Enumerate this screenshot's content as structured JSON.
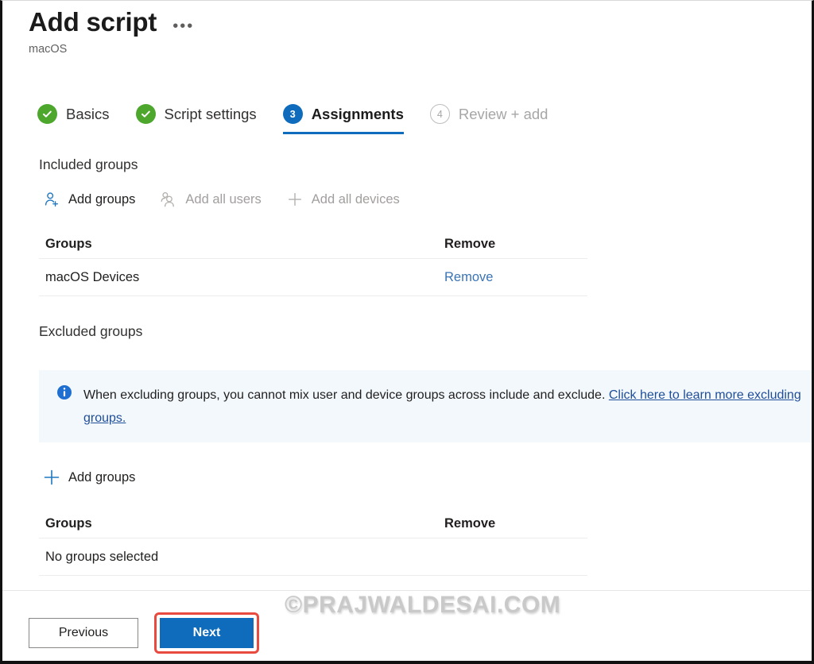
{
  "header": {
    "title": "Add script",
    "subtitle": "macOS",
    "overflow_menu": "•••"
  },
  "wizard": {
    "steps": [
      {
        "label": "Basics",
        "state": "done",
        "badge": "✓",
        "icon": "check-circle-icon"
      },
      {
        "label": "Script settings",
        "state": "done",
        "badge": "✓",
        "icon": "check-circle-icon"
      },
      {
        "label": "Assignments",
        "state": "active",
        "badge": "3",
        "icon": "step-badge-3"
      },
      {
        "label": "Review + add",
        "state": "todo",
        "badge": "4",
        "icon": "step-badge-4"
      }
    ]
  },
  "included": {
    "heading": "Included groups",
    "commands": [
      {
        "label": "Add groups",
        "icon": "person-add-icon",
        "enabled": true
      },
      {
        "label": "Add all users",
        "icon": "people-icon",
        "enabled": false
      },
      {
        "label": "Add all devices",
        "icon": "plus-icon",
        "enabled": false
      }
    ],
    "columns": [
      "Groups",
      "Remove"
    ],
    "rows": [
      {
        "group": "macOS Devices",
        "remove": "Remove"
      }
    ]
  },
  "excluded": {
    "heading": "Excluded groups",
    "banner": {
      "icon": "info-icon",
      "text": "When excluding groups, you cannot mix user and device groups across include and exclude. ",
      "link_text": "Click here to learn more excluding groups."
    },
    "commands": [
      {
        "label": "Add groups",
        "icon": "plus-icon",
        "enabled": true
      }
    ],
    "columns": [
      "Groups",
      "Remove"
    ],
    "empty_text": "No groups selected"
  },
  "footer": {
    "previous_label": "Previous",
    "next_label": "Next"
  },
  "watermark": "©PRAJWALDESAI.COM",
  "colors": {
    "accent_blue": "#0f6cbd",
    "link_blue": "#3b74b5",
    "banner_link_blue": "#1f4e99",
    "success_green": "#4ca72c",
    "disabled_grey": "#a19f9d",
    "banner_bg": "#f3f8fd",
    "highlight_red": "#e84a3f"
  }
}
